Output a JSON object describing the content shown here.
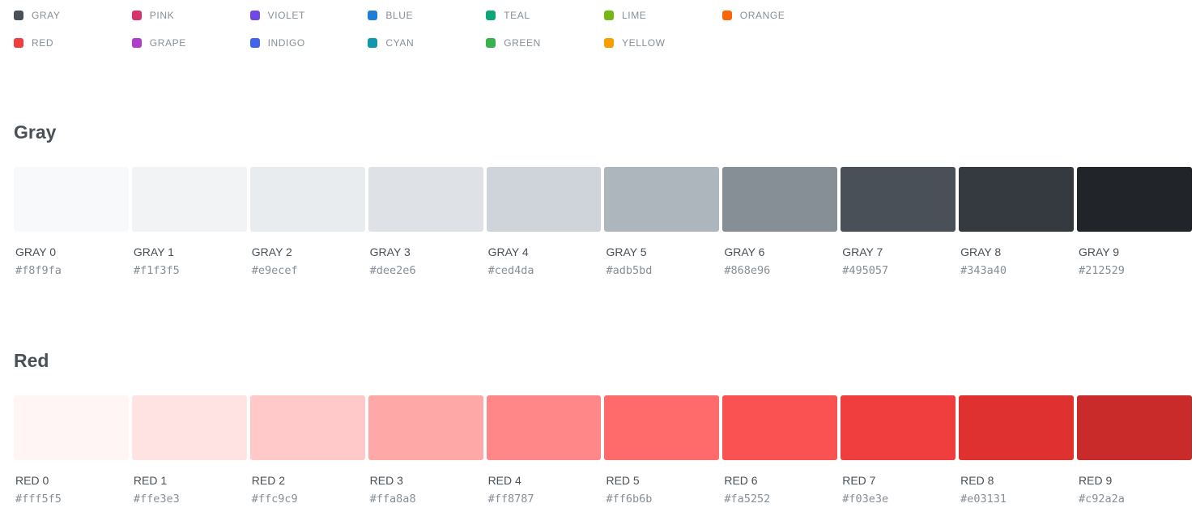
{
  "legend": [
    {
      "label": "GRAY",
      "color": "#495057"
    },
    {
      "label": "PINK",
      "color": "#d6336c"
    },
    {
      "label": "VIOLET",
      "color": "#7048e8"
    },
    {
      "label": "BLUE",
      "color": "#1c7ed6"
    },
    {
      "label": "TEAL",
      "color": "#0ca678"
    },
    {
      "label": "LIME",
      "color": "#74b816"
    },
    {
      "label": "ORANGE",
      "color": "#f76707"
    },
    {
      "label": "RED",
      "color": "#f03e3e"
    },
    {
      "label": "GRAPE",
      "color": "#ae3ec9"
    },
    {
      "label": "INDIGO",
      "color": "#4263eb"
    },
    {
      "label": "CYAN",
      "color": "#1098ad"
    },
    {
      "label": "GREEN",
      "color": "#37b24d"
    },
    {
      "label": "YELLOW",
      "color": "#f59f00"
    }
  ],
  "sections": [
    {
      "title": "Gray",
      "swatches": [
        {
          "name": "GRAY 0",
          "hex": "#f8f9fa"
        },
        {
          "name": "GRAY 1",
          "hex": "#f1f3f5"
        },
        {
          "name": "GRAY 2",
          "hex": "#e9ecef"
        },
        {
          "name": "GRAY 3",
          "hex": "#dee2e6"
        },
        {
          "name": "GRAY 4",
          "hex": "#ced4da"
        },
        {
          "name": "GRAY 5",
          "hex": "#adb5bd"
        },
        {
          "name": "GRAY 6",
          "hex": "#868e96"
        },
        {
          "name": "GRAY 7",
          "hex": "#495057"
        },
        {
          "name": "GRAY 8",
          "hex": "#343a40"
        },
        {
          "name": "GRAY 9",
          "hex": "#212529"
        }
      ]
    },
    {
      "title": "Red",
      "swatches": [
        {
          "name": "RED 0",
          "hex": "#fff5f5"
        },
        {
          "name": "RED 1",
          "hex": "#ffe3e3"
        },
        {
          "name": "RED 2",
          "hex": "#ffc9c9"
        },
        {
          "name": "RED 3",
          "hex": "#ffa8a8"
        },
        {
          "name": "RED 4",
          "hex": "#ff8787"
        },
        {
          "name": "RED 5",
          "hex": "#ff6b6b"
        },
        {
          "name": "RED 6",
          "hex": "#fa5252"
        },
        {
          "name": "RED 7",
          "hex": "#f03e3e"
        },
        {
          "name": "RED 8",
          "hex": "#e03131"
        },
        {
          "name": "RED 9",
          "hex": "#c92a2a"
        }
      ]
    }
  ]
}
